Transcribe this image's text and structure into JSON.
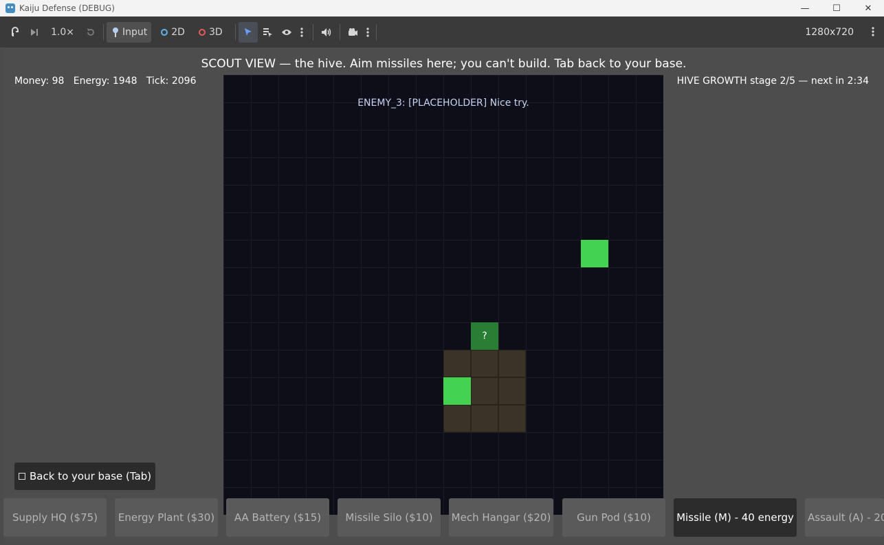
{
  "window": {
    "title": "Kaiju Defense (DEBUG)",
    "controls": [
      "—",
      "☐",
      "✕"
    ]
  },
  "toolbar": {
    "speed": "1.0×",
    "input_label": "Input",
    "mode_2d": "2D",
    "mode_3d": "3D",
    "resolution": "1280x720"
  },
  "hud": {
    "headline": "SCOUT VIEW — the hive. Aim missiles here; you can't build. Tab back to your base.",
    "stats": "Money: 98   Energy: 1948   Tick: 2096",
    "hive_status": "HIVE GROWTH stage 2/5 — next in 2:34",
    "enemy_message": "ENEMY_3: [PLACEHOLDER] Nice try.",
    "unknown_marker": "?"
  },
  "back_button": {
    "label": "Back to your base (Tab)"
  },
  "build_bar": {
    "items": [
      {
        "label": "Supply HQ ($75)"
      },
      {
        "label": "Energy Plant ($30)"
      },
      {
        "label": "AA Battery ($15)"
      },
      {
        "label": "Missile Silo ($10)"
      },
      {
        "label": "Mech Hangar ($20)"
      },
      {
        "label": "Gun Pod ($10)"
      },
      {
        "label": "Missile (M) - 40 energy"
      },
      {
        "label": "Assault (A) - 20"
      }
    ],
    "selected_index": 6
  },
  "colors": {
    "grid_bg": "#0e0e18",
    "cell_green": "#44d350",
    "cell_dark_green": "#2a7e34",
    "cell_brown": "#3c3328",
    "accent_blue": "#69a0ff"
  }
}
